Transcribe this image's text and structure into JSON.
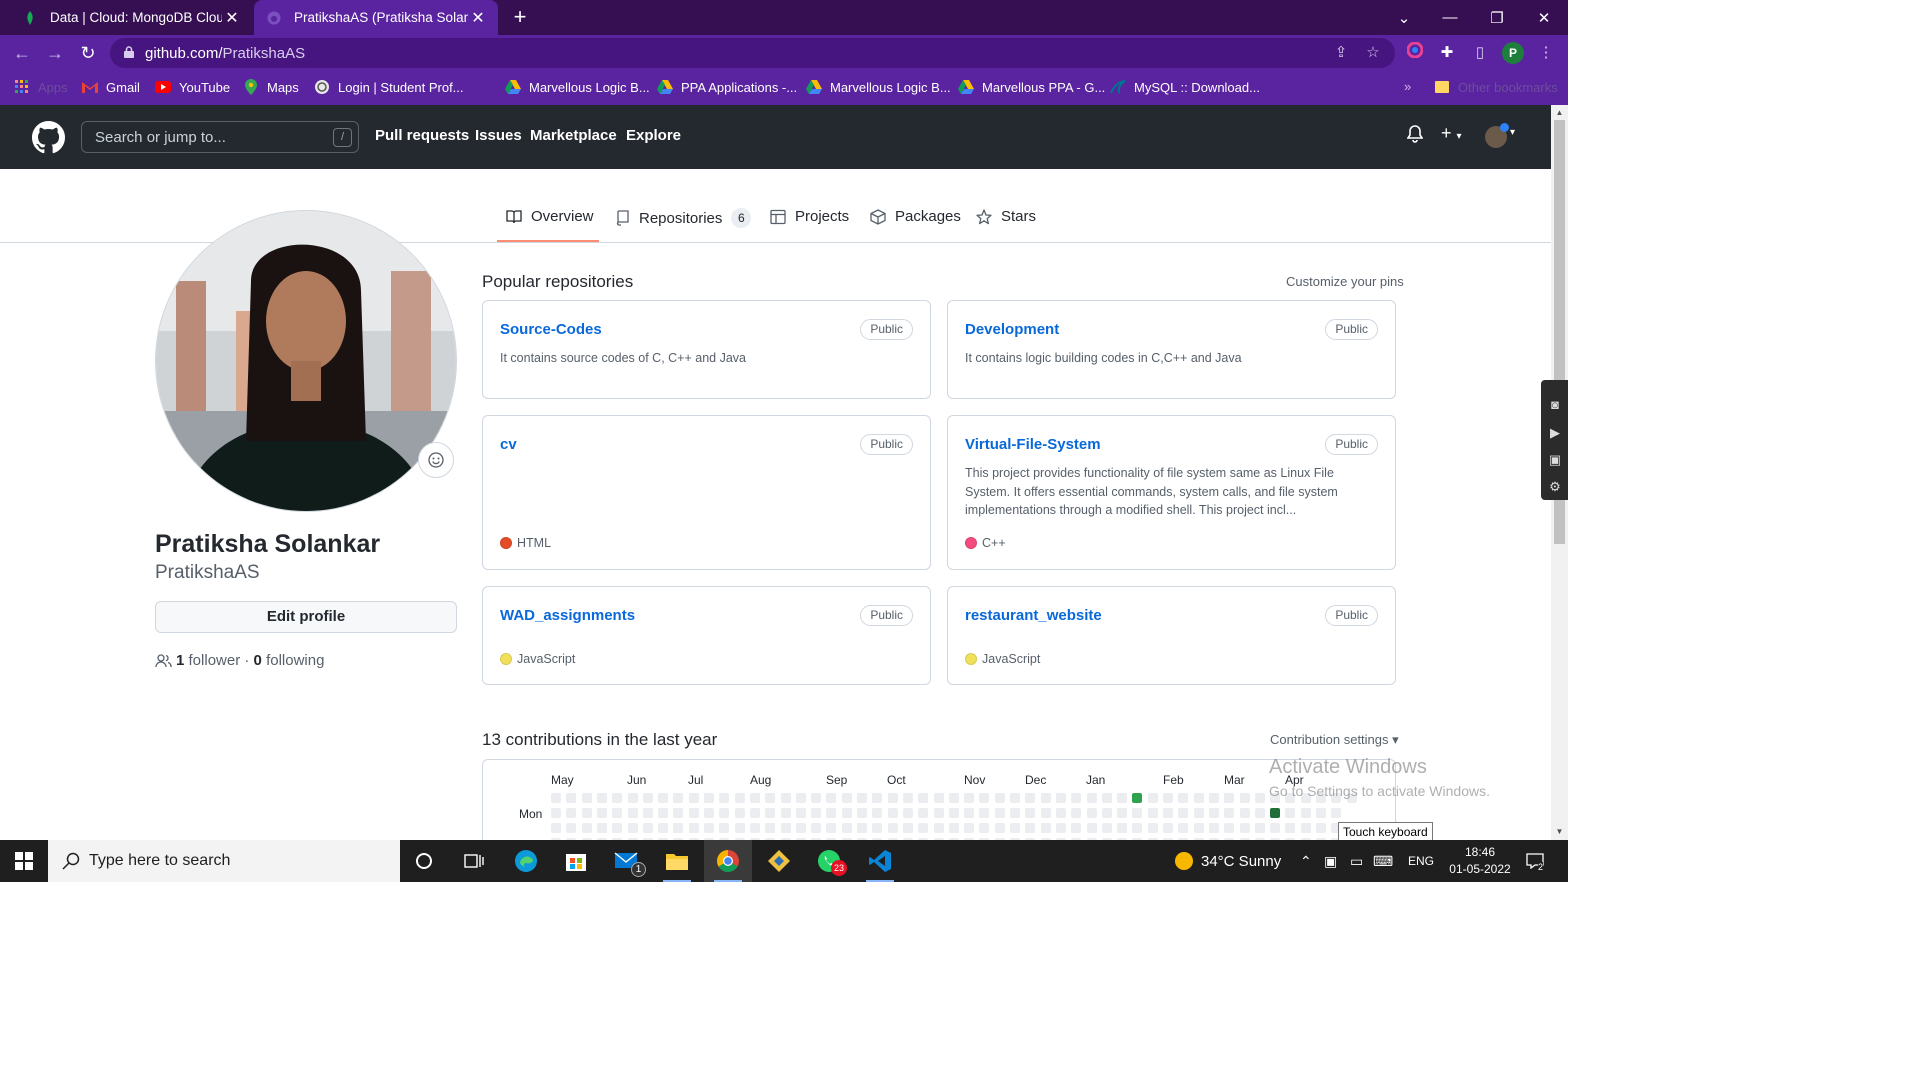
{
  "browser": {
    "tabs": [
      {
        "title": "Data | Cloud: MongoDB Cloud",
        "active": false,
        "icon": "mongodb-leaf-icon"
      },
      {
        "title": "PratikshaAS (Pratiksha Solankar)",
        "active": true,
        "icon": "github-icon"
      }
    ],
    "url_host": "github.com/",
    "url_path": "PratikshaAS",
    "profile_initial": "P",
    "bookmarks": [
      {
        "label": "Apps",
        "icon": "apps-grid-icon"
      },
      {
        "label": "Gmail",
        "icon": "gmail-icon"
      },
      {
        "label": "YouTube",
        "icon": "youtube-icon"
      },
      {
        "label": "Maps",
        "icon": "maps-icon"
      },
      {
        "label": "Login | Student Prof...",
        "icon": "student-portal-icon"
      },
      {
        "label": "Marvellous Logic B...",
        "icon": "google-drive-icon"
      },
      {
        "label": "PPA Applications -...",
        "icon": "google-drive-icon"
      },
      {
        "label": "Marvellous Logic B...",
        "icon": "google-drive-icon"
      },
      {
        "label": "Marvellous PPA - G...",
        "icon": "google-drive-icon"
      },
      {
        "label": "MySQL :: Download...",
        "icon": "mysql-icon"
      }
    ],
    "more_bookmarks": "»",
    "other_bookmarks": "Other bookmarks"
  },
  "github_header": {
    "search_placeholder": "Search or jump to...",
    "search_shortcut": "/",
    "nav": [
      "Pull requests",
      "Issues",
      "Marketplace",
      "Explore"
    ]
  },
  "profile_tabs": [
    {
      "label": "Overview",
      "icon": "book-icon",
      "selected": true
    },
    {
      "label": "Repositories",
      "icon": "repo-icon",
      "count": "6"
    },
    {
      "label": "Projects",
      "icon": "table-icon"
    },
    {
      "label": "Packages",
      "icon": "package-icon"
    },
    {
      "label": "Stars",
      "icon": "star-icon"
    }
  ],
  "profile": {
    "name": "Pratiksha Solankar",
    "login": "PratikshaAS",
    "edit_label": "Edit profile",
    "followers_count": "1",
    "followers_label": "follower",
    "separator": "·",
    "following_count": "0",
    "following_label": "following"
  },
  "popular": {
    "title": "Popular repositories",
    "customize": "Customize your pins",
    "repos": [
      {
        "name": "Source-Codes",
        "visibility": "Public",
        "description": "It contains source codes of C, C++ and Java",
        "language": "",
        "lang_color": ""
      },
      {
        "name": "Development",
        "visibility": "Public",
        "description": "It contains logic building codes in C,C++ and Java",
        "language": "",
        "lang_color": ""
      },
      {
        "name": "cv",
        "visibility": "Public",
        "description": "",
        "language": "HTML",
        "lang_color": "#e34c26"
      },
      {
        "name": "Virtual-File-System",
        "visibility": "Public",
        "description": "This project provides functionality of file system same as Linux File System. It offers essential commands, system calls, and file system implementations through a modified shell. This project incl...",
        "language": "C++",
        "lang_color": "#f34b7d"
      },
      {
        "name": "WAD_assignments",
        "visibility": "Public",
        "description": "",
        "language": "JavaScript",
        "lang_color": "#f1e05a"
      },
      {
        "name": "restaurant_website",
        "visibility": "Public",
        "description": "",
        "language": "JavaScript",
        "lang_color": "#f1e05a"
      }
    ]
  },
  "contributions": {
    "title": "13 contributions in the last year",
    "settings": "Contribution settings ▾",
    "months": [
      "May",
      "Jun",
      "Jul",
      "Aug",
      "Sep",
      "Oct",
      "Nov",
      "Dec",
      "Jan",
      "Feb",
      "Mar",
      "Apr"
    ],
    "day_label": "Mon"
  },
  "windows": {
    "activate_title": "Activate Windows",
    "activate_sub": "Go to Settings to activate Windows.",
    "touch_keyboard_tip": "Touch keyboard",
    "search_placeholder": "Type here to search",
    "weather": "34°C  Sunny",
    "lang": "ENG",
    "time": "18:46",
    "date": "01-05-2022",
    "whatsapp_badge": "23",
    "mail_badge": "1",
    "notif_badge": "2"
  },
  "colors": {
    "chrome_frame": "#350f52",
    "chrome_toolbar": "#5a23a0",
    "gh_header": "#24292f",
    "link": "#0969da",
    "tab_underline": "#fd8c73",
    "contrib_green": "#216e39"
  }
}
